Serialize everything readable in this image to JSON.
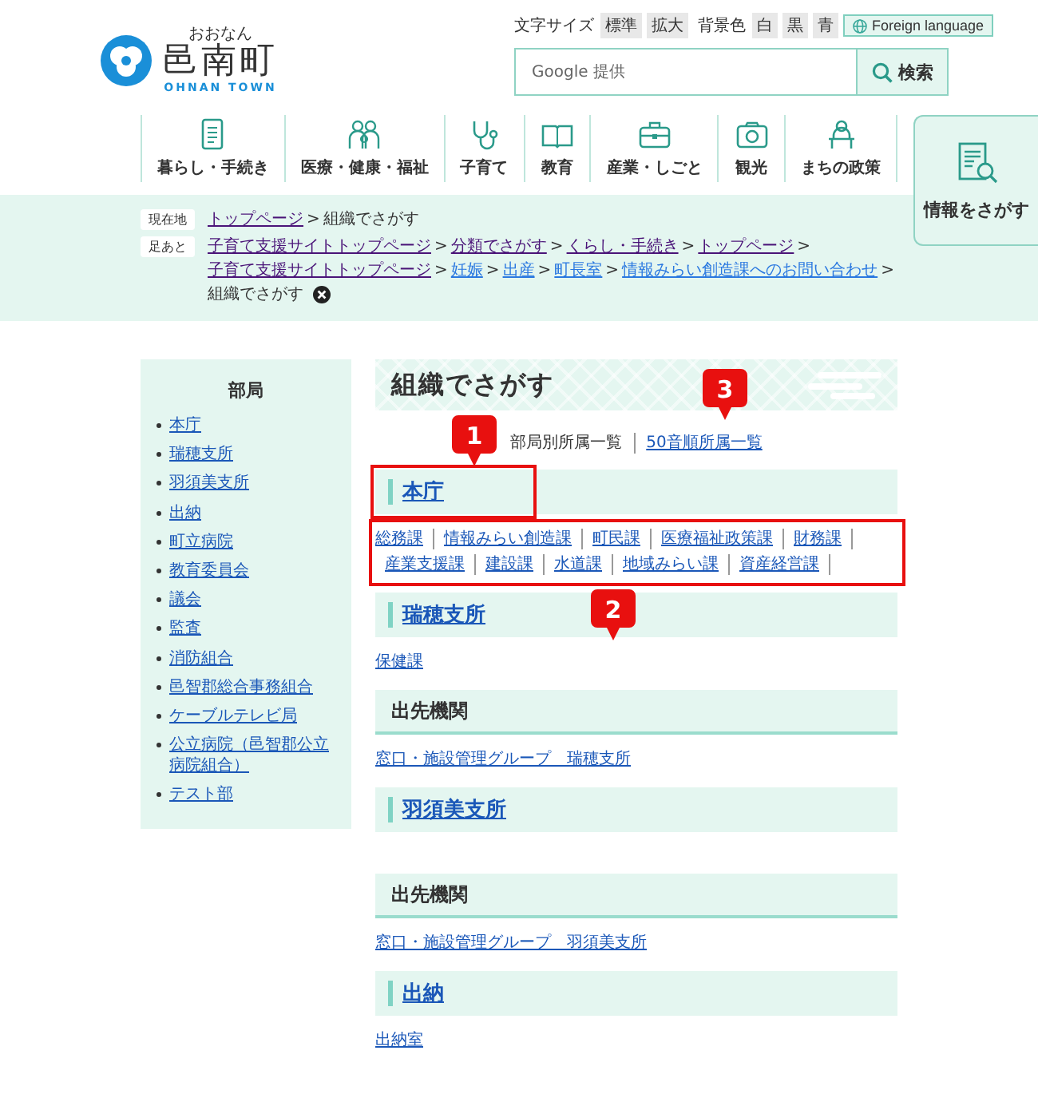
{
  "site": {
    "ruby": "おおなん",
    "name": "邑南町",
    "roman": "OHNAN TOWN"
  },
  "tools": {
    "text_size_label": "文字サイズ",
    "text_size_options": [
      {
        "label": "標準"
      },
      {
        "label": "拡大"
      }
    ],
    "bg_label": "背景色",
    "bg_options": [
      {
        "label": "白"
      },
      {
        "label": "黒"
      },
      {
        "label": "青"
      }
    ],
    "foreign_language": "Foreign language"
  },
  "search": {
    "placeholder": "Google 提供",
    "button": "検索"
  },
  "nav": [
    {
      "label": "暮らし・手続き"
    },
    {
      "label": "医療・健康・福祉"
    },
    {
      "label": "子育て"
    },
    {
      "label": "教育"
    },
    {
      "label": "産業・しごと"
    },
    {
      "label": "観光"
    },
    {
      "label": "まちの政策"
    }
  ],
  "info_search": "情報をさがす",
  "breadcrumb": {
    "label": "現在地",
    "separator": ">",
    "items": [
      {
        "text": "トップページ",
        "kind": "link",
        "visited": true
      },
      {
        "text": "組織でさがす",
        "kind": "current"
      }
    ]
  },
  "footsteps": {
    "label": "足あと",
    "separator": ">",
    "items": [
      {
        "text": "子育て支援サイトトップページ",
        "kind": "link",
        "visited": true
      },
      {
        "text": "分類でさがす",
        "kind": "link",
        "visited": true
      },
      {
        "text": "くらし・手続き",
        "kind": "link",
        "visited": true
      },
      {
        "text": "トップページ",
        "kind": "link",
        "visited": true
      },
      {
        "text": "子育て支援サイトトップページ",
        "kind": "link",
        "visited": true
      },
      {
        "text": "妊娠",
        "kind": "link",
        "visited": false
      },
      {
        "text": "出産",
        "kind": "link",
        "visited": false
      },
      {
        "text": "町長室",
        "kind": "link",
        "visited": false
      },
      {
        "text": "情報みらい創造課へのお問い合わせ",
        "kind": "link",
        "visited": false
      },
      {
        "text": "組織でさがす",
        "kind": "current"
      }
    ]
  },
  "sidebar": {
    "title": "部局",
    "items": [
      "本庁",
      "瑞穂支所",
      "羽須美支所",
      "出納",
      "町立病院",
      "教育委員会",
      "議会",
      "監査",
      "消防組合",
      "邑智郡総合事務組合",
      "ケーブルテレビ局",
      "公立病院（邑智郡公立病院組合）",
      "テスト部"
    ]
  },
  "page_title": "組織でさがす",
  "view_tabs": [
    {
      "label": "部局別所属一覧",
      "selected": true
    },
    {
      "label": "50音順所属一覧",
      "selected": false,
      "callout": "3"
    }
  ],
  "sections": [
    {
      "kind": "dept",
      "title": "本庁",
      "heading_callout": "1",
      "links_callout": "2",
      "links": [
        "総務課",
        "情報みらい創造課",
        "町民課",
        "医療福祉政策課",
        "財務課",
        "産業支援課",
        "建設課",
        "水道課",
        "地域みらい課",
        "資産経営課"
      ]
    },
    {
      "kind": "dept",
      "title": "瑞穂支所",
      "links": [
        "保健課"
      ]
    },
    {
      "kind": "outpost",
      "title": "出先機関",
      "links": [
        "窓口・施設管理グループ　瑞穂支所"
      ]
    },
    {
      "kind": "dept",
      "title": "羽須美支所"
    },
    {
      "kind": "outpost",
      "title": "出先機関",
      "links": [
        "窓口・施設管理グループ　羽須美支所"
      ]
    },
    {
      "kind": "dept",
      "title": "出納",
      "links": [
        "出納室"
      ]
    }
  ]
}
